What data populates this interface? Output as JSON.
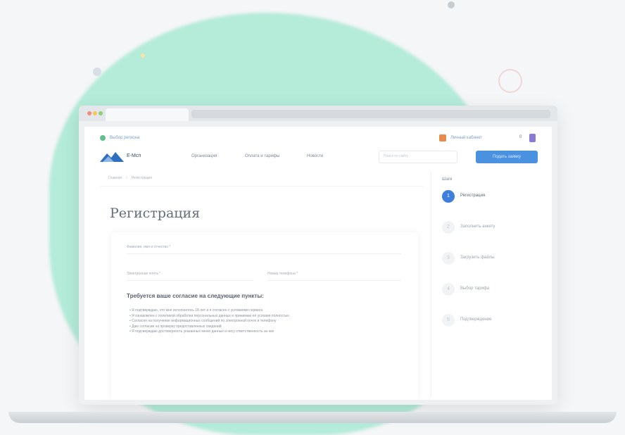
{
  "colors": {
    "accent_green": "#b4ebd9",
    "primary_blue": "#4a92e0",
    "step_active": "#3f7fdc",
    "badge_orange": "#e98a4d",
    "badge_purple": "#8a7ad4"
  },
  "topbar": {
    "left_link": "Выбор региона",
    "right_link": "Личный кабинет",
    "counter": "0"
  },
  "header": {
    "logo_text": "Е-Мсп",
    "nav": [
      "Организация",
      "Оплата и тарифы",
      "Новости"
    ],
    "search_placeholder": "Поиск по сайту",
    "cta_label": "Подать заявку"
  },
  "breadcrumb": [
    "Главная",
    "Регистрация"
  ],
  "page": {
    "title": "Регистрация"
  },
  "form": {
    "field_fullname": "Фамилия, имя и отчество *",
    "field_email": "Электронная почта *",
    "field_phone": "Номер телефона *",
    "requirements_title": "Требуется ваше согласие на следующие пункты:",
    "requirements": [
      "Я подтверждаю, что мне исполнилось 18 лет и я согласен с условиями сервиса",
      "Я ознакомлен с политикой обработки персональных данных и принимаю её условия полностью",
      "Согласен на получение информационных сообщений по электронной почте и телефону",
      "Даю согласие на проверку предоставленных сведений",
      "Я подтверждаю достоверность указанных мною данных и несу ответственность за них"
    ]
  },
  "sidebar": {
    "heading": "Шаги",
    "steps": [
      {
        "num": "1",
        "label": "Регистрация",
        "active": true
      },
      {
        "num": "2",
        "label": "Заполнить анкету",
        "active": false
      },
      {
        "num": "3",
        "label": "Загрузить файлы",
        "active": false
      },
      {
        "num": "4",
        "label": "Выбор тарифа",
        "active": false
      },
      {
        "num": "5",
        "label": "Подтверждение",
        "active": false
      }
    ]
  }
}
